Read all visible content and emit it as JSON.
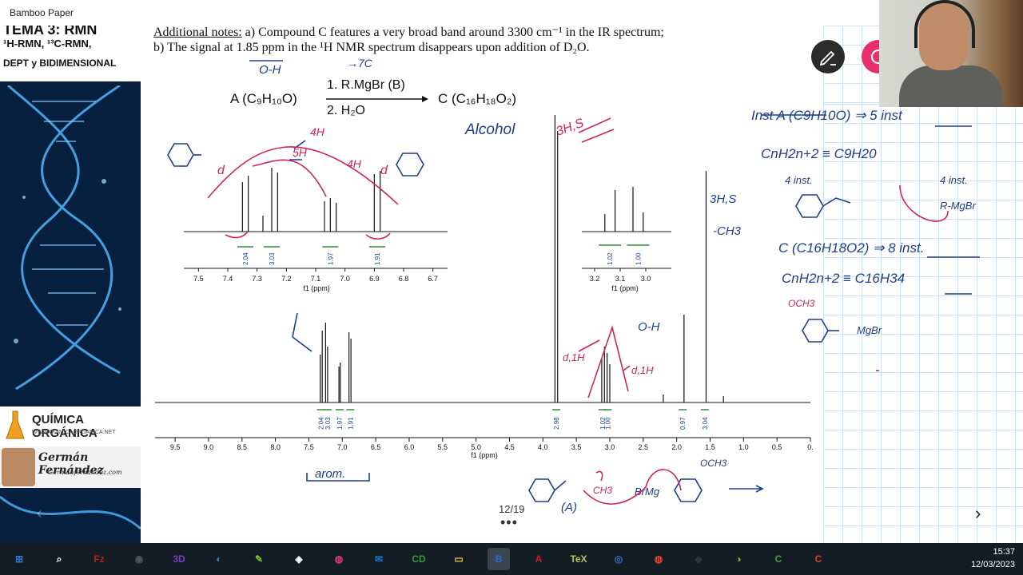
{
  "window": {
    "title": "Bamboo Paper"
  },
  "left_panel": {
    "topic_line1": "TEMA 3: RMN",
    "topic_line2": "¹H-RMN, ¹³C-RMN,",
    "topic_line3": "DEPT y BIDIMENSIONAL",
    "brand_title": "QUÍMICA ORGÁNICA",
    "brand_url": "WWW.QUIMICAORGANICA.NET",
    "author_name": "Germán Fernández",
    "author_site": "Germanfernandez.com"
  },
  "slide": {
    "notes_label": "Additional notes:",
    "notes_a": " a) Compound C features a very broad band around 3300 cm⁻¹ in the IR spectrum;",
    "notes_b": "b) The signal at 1.85 ppm in the ¹H NMR spectrum disappears upon addition of D₂O.",
    "reagent_1": "1. R.MgBr (B)",
    "reagent_2": "2. H₂O",
    "compound_a": "A (C₉H₁₀O)",
    "compound_c": "C (C₁₆H₁₈O₂)",
    "page_indicator": "12/19",
    "more": "•••"
  },
  "spectrum": {
    "main_ticks": [
      "9.5",
      "9.0",
      "8.5",
      "8.0",
      "7.5",
      "7.0",
      "6.5",
      "6.0",
      "5.5",
      "5.0",
      "4.5",
      "4.0",
      "3.5",
      "3.0",
      "2.5",
      "2.0",
      "1.5",
      "1.0",
      "0.5",
      "0."
    ],
    "main_xlabel": "f1 (ppm)",
    "main_integrals": [
      "2.04",
      "3.03",
      "1.97",
      "1.91",
      "2.98",
      "1.02",
      "1.00",
      "0.97",
      "3.04"
    ],
    "inset1_ticks": [
      "7.5",
      "7.4",
      "7.3",
      "7.2",
      "7.1",
      "7.0",
      "6.9",
      "6.8",
      "6.7"
    ],
    "inset1_xlabel": "f1 (ppm)",
    "inset1_integrals": [
      "2.04",
      "3.03",
      "1.97",
      "1.91"
    ],
    "inset2_ticks": [
      "3.2",
      "3.1",
      "3.0"
    ],
    "inset2_xlabel": "f1 (ppm)",
    "inset2_integrals": [
      "1.02",
      "1.00"
    ]
  },
  "handwriting": {
    "oh_top": "O-H",
    "seven_c": "→7C",
    "alcohol": "Alcohol",
    "three_h_s": "3H,S",
    "four_h_top": "4H",
    "five_h": "5H",
    "four_h_right": "4H",
    "d_left": "d",
    "d_right": "d",
    "three_h_s_right": "3H,S",
    "ch3_right": "-CH3",
    "oh_mid": "O-H",
    "d1h_left": "d,1H",
    "d1h_right": "d,1H",
    "arom": "arom.",
    "label_a": "(A)",
    "ch3_bottom": "CH3",
    "brmg": "BrMg",
    "och3_bottom": "OCH3",
    "right_line1": "Inst  A (C9H10O) ⇒ 5 inst",
    "right_line2": "CnH2n+2 ≡ C9H20",
    "right_4inst_a": "4 inst.",
    "right_4inst_b": "4 inst.",
    "right_rmgbr": "R-MgBr",
    "right_line3": "C (C16H18O2) ⇒ 8 inst.",
    "right_line4": "CnH2n+2 ≡ C16H34",
    "right_och3": "OCH3",
    "right_mgbr": "MgBr"
  },
  "taskbar": {
    "icons": [
      "windows-start",
      "search",
      "filezilla",
      "media",
      "3d-builder",
      "photos",
      "notepad-plus",
      "fiddle",
      "paint-3d",
      "mail",
      "chemdraw",
      "folder",
      "bamboo-paper",
      "acrobat",
      "texworks",
      "browser-blue",
      "chrome",
      "inkscape",
      "android",
      "camtasia-green",
      "camtasia-red"
    ],
    "time": "15:37",
    "date": "12/03/2023"
  },
  "colors": {
    "ink_blue": "#1d3f8a",
    "ink_pink": "#d0245e",
    "integral_green": "#2e8b3a",
    "taskbar_bg": "#151d24",
    "pink_button": "#e8306e"
  }
}
